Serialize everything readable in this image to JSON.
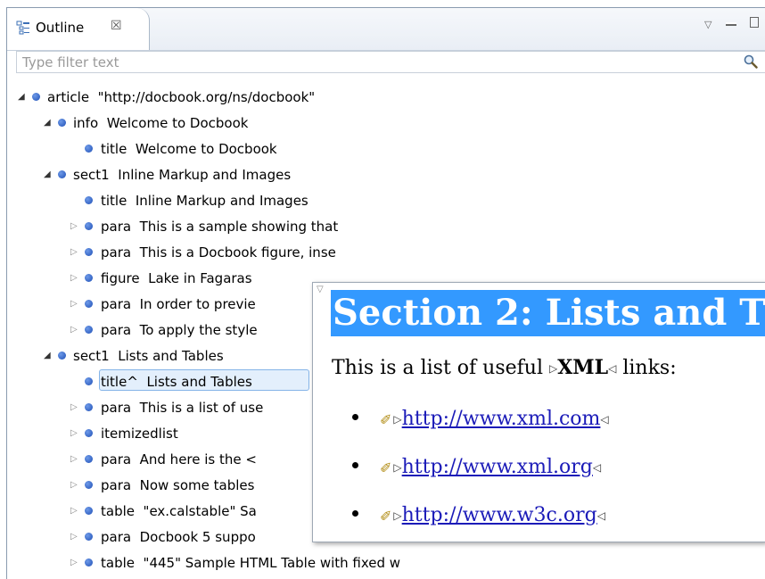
{
  "view": {
    "tab_title": "Outline",
    "tab_close": "☒",
    "filter_placeholder": "Type filter text"
  },
  "tree": [
    {
      "tag": "article",
      "text": "\"http://docbook.org/ns/docbook\"",
      "level": 0,
      "state": "open"
    },
    {
      "tag": "info",
      "text": "Welcome to Docbook",
      "level": 1,
      "state": "open"
    },
    {
      "tag": "title",
      "text": "Welcome to Docbook",
      "level": 2,
      "state": "leaf"
    },
    {
      "tag": "sect1",
      "text": "Inline Markup and Images",
      "level": 1,
      "state": "open"
    },
    {
      "tag": "title",
      "text": "Inline Markup and Images",
      "level": 2,
      "state": "leaf"
    },
    {
      "tag": "para",
      "text": "This is a sample showing that",
      "level": 2,
      "state": "closed"
    },
    {
      "tag": "para",
      "text": "This is a Docbook figure, inse",
      "level": 2,
      "state": "closed"
    },
    {
      "tag": "figure",
      "text": "Lake in Fagaras",
      "level": 2,
      "state": "closed"
    },
    {
      "tag": "para",
      "text": "In order to previe",
      "level": 2,
      "state": "closed"
    },
    {
      "tag": "para",
      "text": "To apply the style",
      "level": 2,
      "state": "closed"
    },
    {
      "tag": "sect1",
      "text": "Lists and Tables",
      "level": 1,
      "state": "open"
    },
    {
      "tag": "title^",
      "text": "Lists and Tables",
      "level": 2,
      "state": "leaf",
      "selected": true
    },
    {
      "tag": "para",
      "text": "This is a list of use",
      "level": 2,
      "state": "closed"
    },
    {
      "tag": "itemizedlist",
      "text": "",
      "level": 2,
      "state": "closed"
    },
    {
      "tag": "para",
      "text": "And here is the <",
      "level": 2,
      "state": "closed"
    },
    {
      "tag": "para",
      "text": "Now some tables",
      "level": 2,
      "state": "closed"
    },
    {
      "tag": "table",
      "text": "\"ex.calstable\" Sa",
      "level": 2,
      "state": "closed"
    },
    {
      "tag": "para",
      "text": "Docbook 5 suppo",
      "level": 2,
      "state": "closed"
    },
    {
      "tag": "table",
      "text": "\"445\" Sample HTML Table with fixed w",
      "level": 2,
      "state": "closed"
    }
  ],
  "preview": {
    "heading": "Section 2: Lists and T",
    "intro_before": "This is a list of useful ",
    "intro_tag": "XML",
    "intro_after": " links:",
    "links": [
      "http://www.xml.com",
      "http://www.xml.org",
      "http://www.w3c.org"
    ]
  },
  "colors": {
    "node_dot": "#2a5fc9",
    "selection_bg": "#e3effc",
    "heading_bg": "#3399ff",
    "link": "#1b1bb8"
  }
}
